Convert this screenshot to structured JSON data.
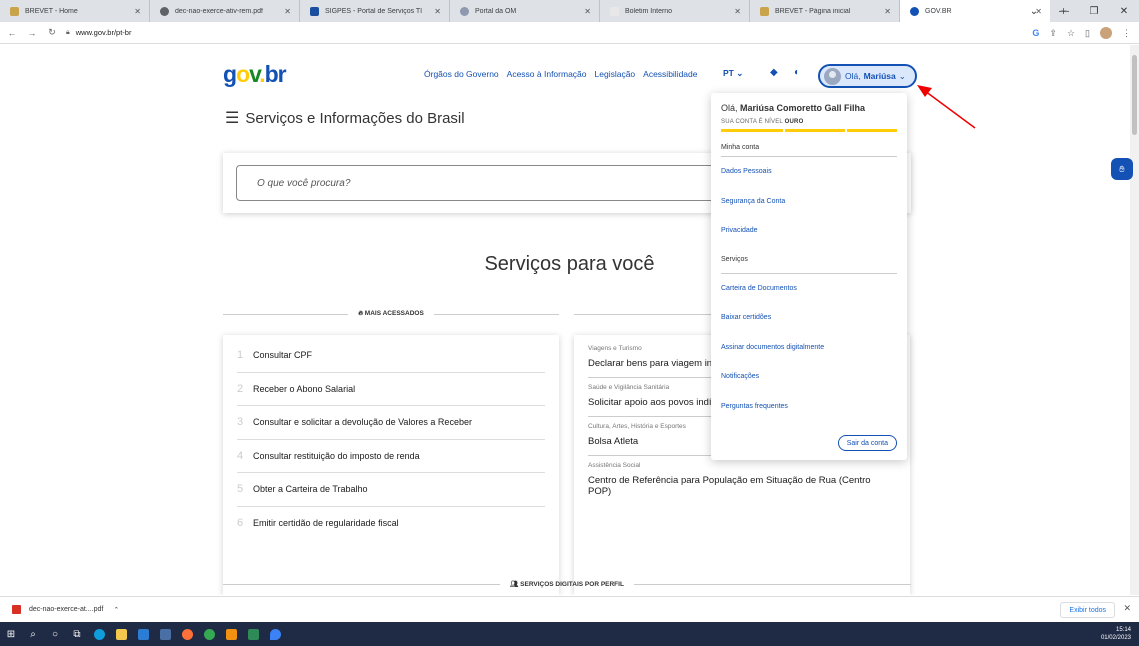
{
  "browser": {
    "tabs": [
      {
        "title": "BREVET - Home",
        "color": "#c9a44a"
      },
      {
        "title": "dec-nao-exerce-ativ-rem.pdf",
        "color": "#5f6368"
      },
      {
        "title": "SIGPES - Portal de Serviços TI",
        "color": "#1a4fa0"
      },
      {
        "title": "Portal da OM",
        "color": "#8d99ae"
      },
      {
        "title": "Boletim Interno",
        "color": "#e8e8e8"
      },
      {
        "title": "BREVET - Página inicial",
        "color": "#c9a44a"
      },
      {
        "title": "GOV.BR",
        "color": "#1351b4"
      }
    ],
    "new_tab": "+",
    "window_controls": [
      "⌄",
      "—",
      "❐",
      "✕"
    ],
    "url": "www.gov.br/pt-br"
  },
  "header": {
    "logo": {
      "g": "g",
      "o": "o",
      "v": "v",
      "dot": ".",
      "br": "br"
    },
    "nav": [
      "Órgãos do Governo",
      "Acesso à Informação",
      "Legislação",
      "Acessibilidade"
    ],
    "lang": "PT",
    "login_greeting": "Olá,",
    "login_name": "Mariúsa"
  },
  "menu_title": "Serviços e Informações do Brasil",
  "search_placeholder": "O que você procura?",
  "section_title": "Serviços para você",
  "most_accessed_label": "MAIS ACESSADOS",
  "most_accessed": [
    {
      "n": "1",
      "label": "Consultar CPF"
    },
    {
      "n": "2",
      "label": "Receber o Abono Salarial"
    },
    {
      "n": "3",
      "label": "Consultar e solicitar a devolução de Valores a Receber"
    },
    {
      "n": "4",
      "label": "Consultar restituição do imposto de renda"
    },
    {
      "n": "5",
      "label": "Obter a Carteira de Trabalho"
    },
    {
      "n": "6",
      "label": "Emitir certidão de regularidade fiscal"
    }
  ],
  "highlights": [
    {
      "category": "Viagens e Turismo",
      "title": "Declarar bens para viagem internacional"
    },
    {
      "category": "Saúde e Vigilância Sanitária",
      "title": "Solicitar apoio aos povos indígenas"
    },
    {
      "category": "Cultura, Artes, História e Esportes",
      "title": "Bolsa Atleta"
    },
    {
      "category": "Assistência Social",
      "title": "Centro de Referência para População em Situação de Rua (Centro POP)"
    }
  ],
  "bottom_label": "SERVIÇOS DIGITAIS POR PERFIL",
  "dropdown": {
    "greeting": "Olá,",
    "full_name": "Mariúsa Comoretto Gall Filha",
    "level_prefix": "SUA CONTA É NÍVEL",
    "level": "OURO",
    "account_head": "Minha conta",
    "account_items": [
      "Dados Pessoais",
      "Segurança da Conta",
      "Privacidade"
    ],
    "services_head": "Serviços",
    "service_items": [
      "Carteira de Documentos",
      "Baixar certidões",
      "Assinar documentos digitalmente",
      "Notificações",
      "Perguntas frequentes"
    ],
    "logout": "Sair da conta"
  },
  "download": {
    "file": "dec-nao-exerce-at....pdf",
    "show_all": "Exibir todos"
  },
  "clock": {
    "time": "15:14",
    "date": "01/02/2023"
  }
}
